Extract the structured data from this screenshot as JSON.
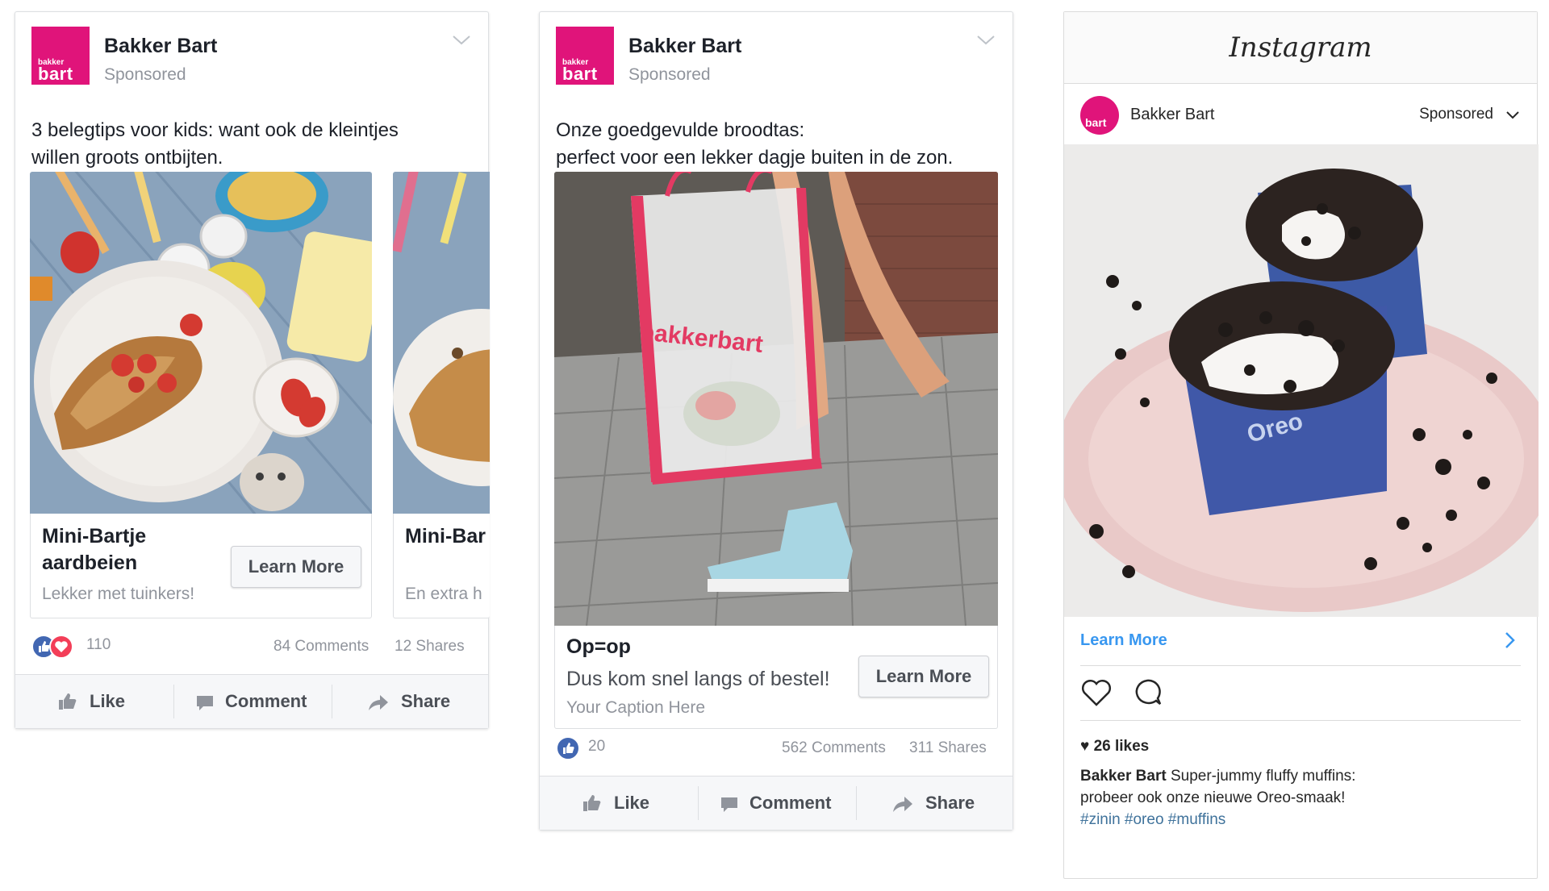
{
  "brand": {
    "page_name": "Bakker Bart",
    "logo_top": "bakker",
    "logo_bottom": "bart",
    "color": "#e0147a"
  },
  "ad1": {
    "sponsored": "Sponsored",
    "text": "3 belegtips voor kids: want ook de kleintjes willen groots ontbijten.",
    "card1": {
      "title": "Mini-Bartje aardbeien",
      "description": "Lekker met tuinkers!",
      "cta": "Learn More"
    },
    "card2": {
      "title": "Mini-Bar",
      "description": "En extra h"
    },
    "reactions": "110",
    "comments": "84 Comments",
    "shares": "12 Shares",
    "actions": {
      "like": "Like",
      "comment": "Comment",
      "share": "Share"
    }
  },
  "ad2": {
    "sponsored": "Sponsored",
    "text_line1": "Onze goedgevulde broodtas:",
    "text_line2": "perfect voor een lekker dagje buiten in de zon.",
    "bag_print": "bakkerbart",
    "headline": "Op=op",
    "description": "Dus kom snel langs of bestel!",
    "caption": "Your Caption Here",
    "cta": "Learn More",
    "reactions": "20",
    "comments": "562 Comments",
    "shares": "311 Shares",
    "actions": {
      "like": "Like",
      "comment": "Comment",
      "share": "Share"
    }
  },
  "instagram": {
    "app_title": "Instagram",
    "account": "Bakker Bart",
    "sponsored": "Sponsored",
    "cta": "Learn More",
    "likes": "26 likes",
    "caption_user": "Bakker Bart",
    "caption_line1": "Super-jummy fluffy muffins:",
    "caption_line2": "probeer ook onze nieuwe Oreo-smaak!",
    "hashtags": "#zinin #oreo #muffins",
    "wrapper_text": "Oreo"
  },
  "colors": {
    "fb_blue": "#4267b2",
    "love_red": "#f33e58",
    "ig_link": "#3897f0"
  }
}
